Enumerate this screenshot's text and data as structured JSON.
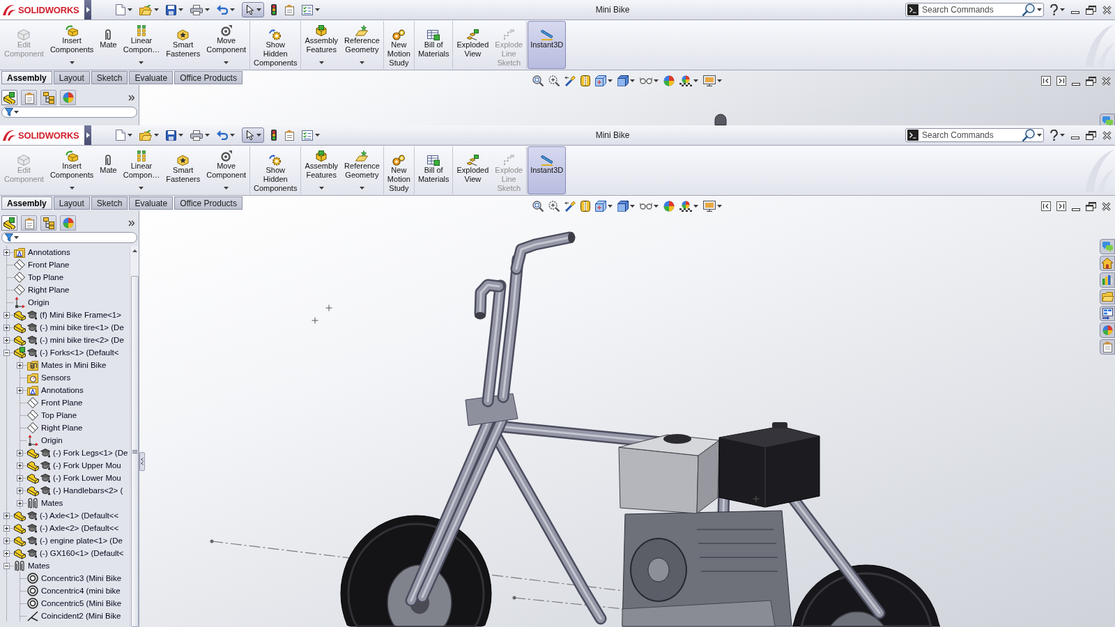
{
  "windows": [
    {
      "kind": "partial",
      "logo": "SOLIDWORKS",
      "select_tool": {
        "on": true
      },
      "title": "Mini Bike",
      "search": {
        "placeholder": "Search Commands"
      },
      "ribbon_groups": [
        {
          "buttons": [
            {
              "label": "Edit Component",
              "disabled": true,
              "dropdown": false,
              "on": false
            },
            {
              "label": "Insert Components",
              "disabled": false,
              "dropdown": true,
              "on": false
            },
            {
              "label": "Mate",
              "disabled": false,
              "dropdown": false,
              "on": false
            },
            {
              "label": "Linear Compon…",
              "disabled": false,
              "dropdown": true,
              "on": false
            },
            {
              "label": "Smart Fasteners",
              "disabled": false,
              "dropdown": false,
              "on": false
            },
            {
              "label": "Move Component",
              "disabled": false,
              "dropdown": true,
              "on": false
            }
          ]
        },
        {
          "buttons": [
            {
              "label": "Show Hidden Components",
              "disabled": false,
              "dropdown": false,
              "on": false
            }
          ]
        },
        {
          "buttons": [
            {
              "label": "Assembly Features",
              "disabled": false,
              "dropdown": true,
              "on": false
            },
            {
              "label": "Reference Geometry",
              "disabled": false,
              "dropdown": true,
              "on": false
            }
          ]
        },
        {
          "buttons": [
            {
              "label": "New Motion Study",
              "disabled": false,
              "dropdown": false,
              "on": false
            }
          ]
        },
        {
          "buttons": [
            {
              "label": "Bill of Materials",
              "disabled": false,
              "dropdown": false,
              "on": false
            }
          ]
        },
        {
          "buttons": [
            {
              "label": "Exploded View",
              "disabled": false,
              "dropdown": false,
              "on": false
            },
            {
              "label": "Explode Line Sketch",
              "disabled": true,
              "dropdown": false,
              "on": false
            }
          ]
        },
        {
          "buttons": [
            {
              "label": "Instant3D",
              "disabled": false,
              "dropdown": false,
              "on": true
            }
          ]
        }
      ],
      "tabs": [
        {
          "label": "Assembly",
          "selected": true
        },
        {
          "label": "Layout",
          "selected": false
        },
        {
          "label": "Sketch",
          "selected": false
        },
        {
          "label": "Evaluate",
          "selected": false
        },
        {
          "label": "Office Products",
          "selected": false
        }
      ],
      "panel_tabs": [
        {
          "kind": "feature_manager",
          "selected": true
        },
        {
          "kind": "property_manager",
          "selected": false
        },
        {
          "kind": "configuration_manager",
          "selected": false
        },
        {
          "kind": "display_manager",
          "selected": false
        }
      ]
    },
    {
      "kind": "full",
      "logo": "SOLIDWORKS",
      "select_tool": {
        "on": true
      },
      "title": "Mini Bike",
      "search": {
        "placeholder": "Search Commands"
      },
      "ribbon_groups": [
        {
          "buttons": [
            {
              "label": "Edit Component",
              "disabled": true,
              "dropdown": false,
              "on": false
            },
            {
              "label": "Insert Components",
              "disabled": false,
              "dropdown": true,
              "on": false
            },
            {
              "label": "Mate",
              "disabled": false,
              "dropdown": false,
              "on": false
            },
            {
              "label": "Linear Compon…",
              "disabled": false,
              "dropdown": true,
              "on": false
            },
            {
              "label": "Smart Fasteners",
              "disabled": false,
              "dropdown": false,
              "on": false
            },
            {
              "label": "Move Component",
              "disabled": false,
              "dropdown": true,
              "on": false
            }
          ]
        },
        {
          "buttons": [
            {
              "label": "Show Hidden Components",
              "disabled": false,
              "dropdown": false,
              "on": false
            }
          ]
        },
        {
          "buttons": [
            {
              "label": "Assembly Features",
              "disabled": false,
              "dropdown": true,
              "on": false
            },
            {
              "label": "Reference Geometry",
              "disabled": false,
              "dropdown": true,
              "on": false
            }
          ]
        },
        {
          "buttons": [
            {
              "label": "New Motion Study",
              "disabled": false,
              "dropdown": false,
              "on": false
            }
          ]
        },
        {
          "buttons": [
            {
              "label": "Bill of Materials",
              "disabled": false,
              "dropdown": false,
              "on": false
            }
          ]
        },
        {
          "buttons": [
            {
              "label": "Exploded View",
              "disabled": false,
              "dropdown": false,
              "on": false
            },
            {
              "label": "Explode Line Sketch",
              "disabled": true,
              "dropdown": false,
              "on": false
            }
          ]
        },
        {
          "buttons": [
            {
              "label": "Instant3D",
              "disabled": false,
              "dropdown": false,
              "on": true
            }
          ]
        }
      ],
      "tabs": [
        {
          "label": "Assembly",
          "selected": true
        },
        {
          "label": "Layout",
          "selected": false
        },
        {
          "label": "Sketch",
          "selected": false
        },
        {
          "label": "Evaluate",
          "selected": false
        },
        {
          "label": "Office Products",
          "selected": false
        }
      ],
      "panel_tabs": [
        {
          "kind": "feature_manager",
          "selected": true
        },
        {
          "kind": "property_manager",
          "selected": false
        },
        {
          "kind": "configuration_manager",
          "selected": false
        },
        {
          "kind": "display_manager",
          "selected": false
        }
      ],
      "tree": [
        {
          "label": "Annotations",
          "kind": "annotations",
          "expanded": false
        },
        {
          "label": "Front Plane",
          "kind": "plane"
        },
        {
          "label": "Top Plane",
          "kind": "plane"
        },
        {
          "label": "Right Plane",
          "kind": "plane"
        },
        {
          "label": "Origin",
          "kind": "origin"
        },
        {
          "label": "(f) Mini Bike Frame<1>",
          "kind": "part",
          "expanded": false
        },
        {
          "label": "(-) mini bike tire<1> (De",
          "kind": "part",
          "expanded": false
        },
        {
          "label": "(-) mini bike tire<2> (De",
          "kind": "part",
          "expanded": false
        },
        {
          "label": "(-) Forks<1> (Default<",
          "kind": "subassembly",
          "expanded": true,
          "children": [
            {
              "label": "Mates in Mini Bike",
              "kind": "mates_folder",
              "expanded": false
            },
            {
              "label": "Sensors",
              "kind": "sensors"
            },
            {
              "label": "Annotations",
              "kind": "annotations",
              "expanded": false
            },
            {
              "label": "Front Plane",
              "kind": "plane"
            },
            {
              "label": "Top Plane",
              "kind": "plane"
            },
            {
              "label": "Right Plane",
              "kind": "plane"
            },
            {
              "label": "Origin",
              "kind": "origin"
            },
            {
              "label": "(-) Fork Legs<1> (De",
              "kind": "part",
              "expanded": false
            },
            {
              "label": "(-) Fork Upper Mou",
              "kind": "part",
              "expanded": false
            },
            {
              "label": "(-) Fork Lower Mou",
              "kind": "part",
              "expanded": false
            },
            {
              "label": "(-) Handlebars<2> (",
              "kind": "part",
              "expanded": false
            },
            {
              "label": "Mates",
              "kind": "mates",
              "expanded": false
            }
          ]
        },
        {
          "label": "(-) Axle<1> (Default<<",
          "kind": "part",
          "expanded": false
        },
        {
          "label": "(-) Axle<2> (Default<<",
          "kind": "part",
          "expanded": false
        },
        {
          "label": "(-) engine plate<1> (De",
          "kind": "part",
          "expanded": false
        },
        {
          "label": "(-) GX160<1> (Default<",
          "kind": "part",
          "expanded": false
        },
        {
          "label": "Mates",
          "kind": "mates",
          "expanded": true,
          "children": [
            {
              "label": "Concentric3 (Mini Bike",
              "kind": "concentric"
            },
            {
              "label": "Concentric4 (mini bike",
              "kind": "concentric"
            },
            {
              "label": "Concentric5 (Mini Bike",
              "kind": "concentric"
            },
            {
              "label": "Coincident2 (Mini Bike",
              "kind": "coincident"
            }
          ]
        }
      ]
    }
  ]
}
